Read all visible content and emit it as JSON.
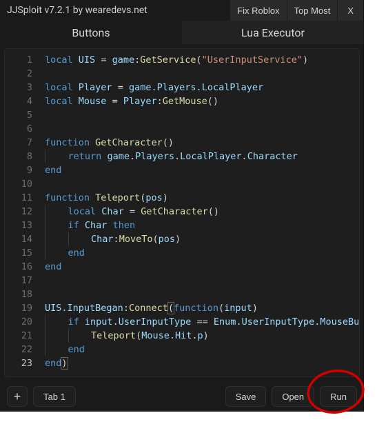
{
  "titlebar": {
    "title": "JJSploit v7.2.1 by wearedevs.net",
    "fix_roblox": "Fix Roblox",
    "top_most": "Top Most",
    "close": "X"
  },
  "tabs": {
    "buttons": "Buttons",
    "lua_executor": "Lua Executor"
  },
  "editor": {
    "current_line": 23,
    "lines": [
      [
        [
          "kw",
          "local"
        ],
        [
          "sp",
          " "
        ],
        [
          "ident",
          "UIS"
        ],
        [
          "sp",
          " "
        ],
        [
          "op",
          "="
        ],
        [
          "sp",
          " "
        ],
        [
          "ident",
          "game"
        ],
        [
          "punc",
          ":"
        ],
        [
          "call",
          "GetService"
        ],
        [
          "punc",
          "("
        ],
        [
          "str",
          "\"UserInputService\""
        ],
        [
          "punc",
          ")"
        ]
      ],
      [],
      [
        [
          "kw",
          "local"
        ],
        [
          "sp",
          " "
        ],
        [
          "ident",
          "Player"
        ],
        [
          "sp",
          " "
        ],
        [
          "op",
          "="
        ],
        [
          "sp",
          " "
        ],
        [
          "ident",
          "game"
        ],
        [
          "punc",
          "."
        ],
        [
          "prop",
          "Players"
        ],
        [
          "punc",
          "."
        ],
        [
          "prop",
          "LocalPlayer"
        ]
      ],
      [
        [
          "kw",
          "local"
        ],
        [
          "sp",
          " "
        ],
        [
          "ident",
          "Mouse"
        ],
        [
          "sp",
          " "
        ],
        [
          "op",
          "="
        ],
        [
          "sp",
          " "
        ],
        [
          "ident",
          "Player"
        ],
        [
          "punc",
          ":"
        ],
        [
          "call",
          "GetMouse"
        ],
        [
          "punc",
          "()"
        ]
      ],
      [],
      [],
      [
        [
          "kw",
          "function"
        ],
        [
          "sp",
          " "
        ],
        [
          "fn",
          "GetCharacter"
        ],
        [
          "punc",
          "()"
        ]
      ],
      [
        [
          "indent",
          1
        ],
        [
          "kw",
          "return"
        ],
        [
          "sp",
          " "
        ],
        [
          "ident",
          "game"
        ],
        [
          "punc",
          "."
        ],
        [
          "prop",
          "Players"
        ],
        [
          "punc",
          "."
        ],
        [
          "prop",
          "LocalPlayer"
        ],
        [
          "punc",
          "."
        ],
        [
          "prop",
          "Character"
        ]
      ],
      [
        [
          "kw",
          "end"
        ]
      ],
      [],
      [
        [
          "kw",
          "function"
        ],
        [
          "sp",
          " "
        ],
        [
          "fn",
          "Teleport"
        ],
        [
          "punc",
          "("
        ],
        [
          "ident",
          "pos"
        ],
        [
          "punc",
          ")"
        ]
      ],
      [
        [
          "indent",
          1
        ],
        [
          "kw",
          "local"
        ],
        [
          "sp",
          " "
        ],
        [
          "ident",
          "Char"
        ],
        [
          "sp",
          " "
        ],
        [
          "op",
          "="
        ],
        [
          "sp",
          " "
        ],
        [
          "call",
          "GetCharacter"
        ],
        [
          "punc",
          "()"
        ]
      ],
      [
        [
          "indent",
          1
        ],
        [
          "kw",
          "if"
        ],
        [
          "sp",
          " "
        ],
        [
          "ident",
          "Char"
        ],
        [
          "sp",
          " "
        ],
        [
          "kw",
          "then"
        ]
      ],
      [
        [
          "indent",
          2
        ],
        [
          "ident",
          "Char"
        ],
        [
          "punc",
          ":"
        ],
        [
          "call",
          "MoveTo"
        ],
        [
          "punc",
          "("
        ],
        [
          "ident",
          "pos"
        ],
        [
          "punc",
          ")"
        ]
      ],
      [
        [
          "indent",
          1
        ],
        [
          "kw",
          "end"
        ]
      ],
      [
        [
          "kw",
          "end"
        ]
      ],
      [],
      [],
      [
        [
          "ident",
          "UIS"
        ],
        [
          "punc",
          "."
        ],
        [
          "prop",
          "InputBegan"
        ],
        [
          "punc",
          ":"
        ],
        [
          "call",
          "Connect"
        ],
        [
          "punc-hl",
          "("
        ],
        [
          "kw",
          "function"
        ],
        [
          "punc",
          "("
        ],
        [
          "ident",
          "input"
        ],
        [
          "punc",
          ")"
        ]
      ],
      [
        [
          "indent",
          1
        ],
        [
          "kw",
          "if"
        ],
        [
          "sp",
          " "
        ],
        [
          "ident",
          "input"
        ],
        [
          "punc",
          "."
        ],
        [
          "prop",
          "UserInputType"
        ],
        [
          "sp",
          " "
        ],
        [
          "op",
          "=="
        ],
        [
          "sp",
          " "
        ],
        [
          "ident",
          "Enum"
        ],
        [
          "punc",
          "."
        ],
        [
          "prop",
          "UserInputType"
        ],
        [
          "punc",
          "."
        ],
        [
          "prop",
          "MouseBut"
        ]
      ],
      [
        [
          "indent",
          2
        ],
        [
          "call",
          "Teleport"
        ],
        [
          "punc",
          "("
        ],
        [
          "ident",
          "Mouse"
        ],
        [
          "punc",
          "."
        ],
        [
          "prop",
          "Hit"
        ],
        [
          "punc",
          "."
        ],
        [
          "prop",
          "p"
        ],
        [
          "punc",
          ")"
        ]
      ],
      [
        [
          "indent",
          1
        ],
        [
          "kw",
          "end"
        ]
      ],
      [
        [
          "kw",
          "end"
        ],
        [
          "punc-hl",
          ")"
        ]
      ]
    ]
  },
  "bottombar": {
    "addtab": "+",
    "tab1": "Tab 1",
    "save": "Save",
    "open": "Open",
    "run": "Run"
  }
}
